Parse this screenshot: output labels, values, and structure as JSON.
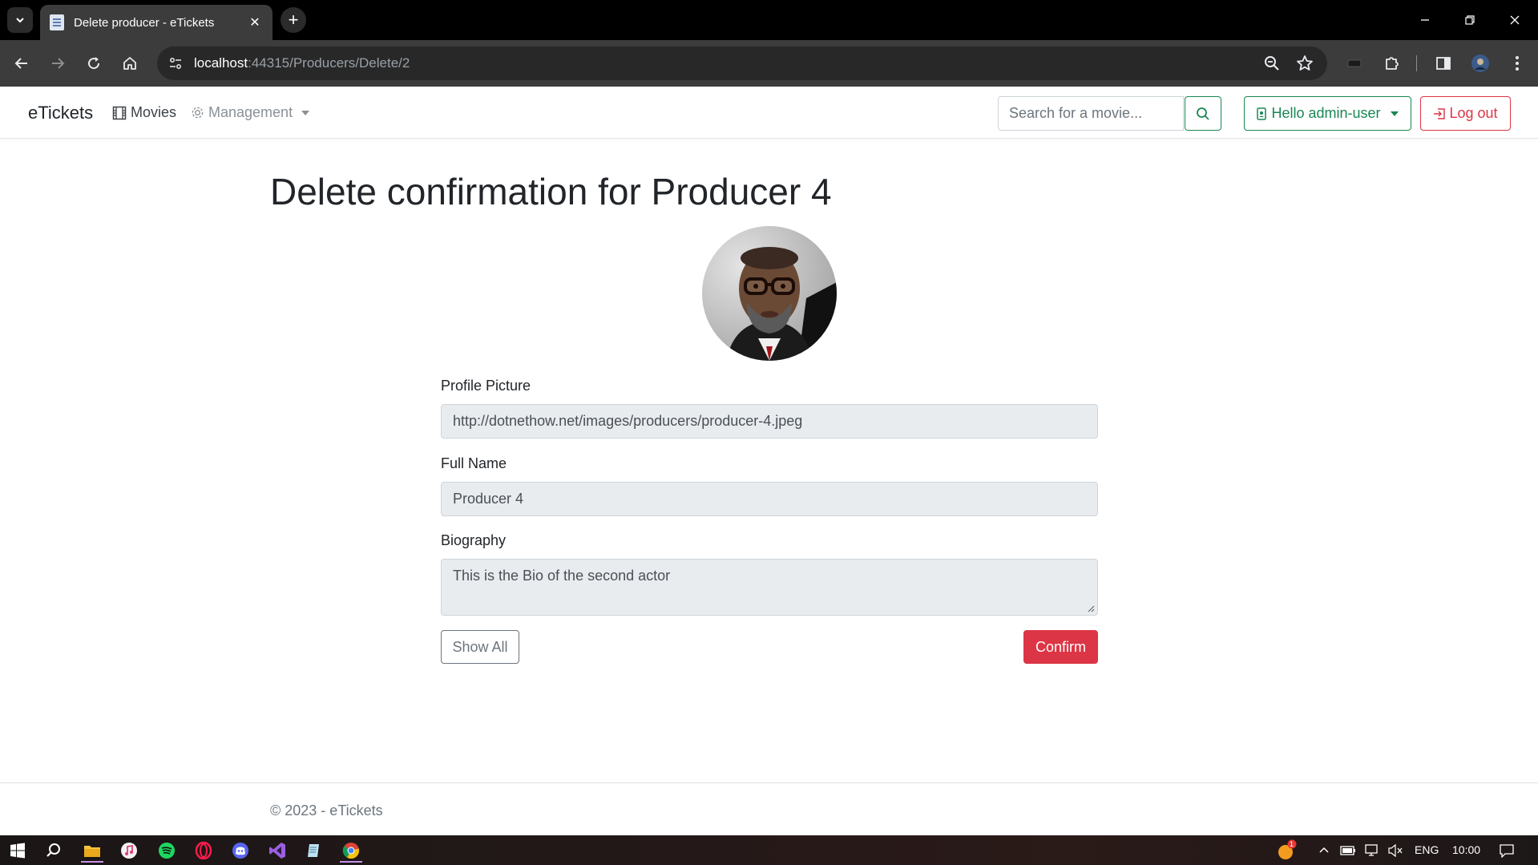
{
  "browser": {
    "tab_title": "Delete producer - eTickets",
    "url_host": "localhost",
    "url_rest": ":44315/Producers/Delete/2"
  },
  "navbar": {
    "brand": "eTickets",
    "movies": "Movies",
    "management": "Management",
    "search_placeholder": "Search for a movie...",
    "user_button": "Hello admin-user",
    "logout_button": "Log out"
  },
  "page": {
    "title": "Delete confirmation for Producer 4",
    "fields": {
      "profile_picture_label": "Profile Picture",
      "profile_picture_value": "http://dotnethow.net/images/producers/producer-4.jpeg",
      "full_name_label": "Full Name",
      "full_name_value": "Producer 4",
      "biography_label": "Biography",
      "biography_value": "This is the Bio of the second actor"
    },
    "show_all_button": "Show All",
    "confirm_button": "Confirm"
  },
  "footer": {
    "text": "© 2023 - eTickets"
  },
  "taskbar": {
    "language": "ENG",
    "clock": "10:00",
    "notification_count": "1"
  },
  "colors": {
    "success": "#198754",
    "danger": "#dc3545",
    "secondary": "#6c757d",
    "readonly_bg": "#e9ecef"
  }
}
